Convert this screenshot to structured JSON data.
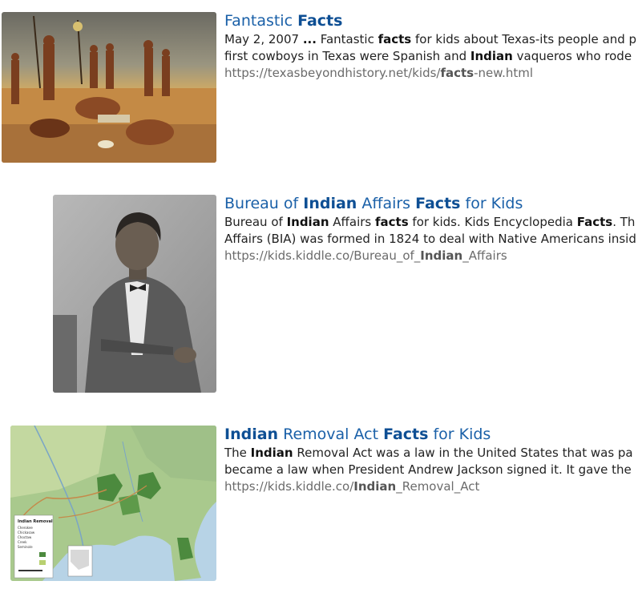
{
  "results": [
    {
      "title": [
        {
          "t": "Fantastic ",
          "b": false
        },
        {
          "t": "Facts",
          "b": true
        }
      ],
      "line1": [
        {
          "t": "May 2, 2007 ",
          "b": false
        },
        {
          "t": "...",
          "b": true
        },
        {
          "t": " Fantastic ",
          "b": false
        },
        {
          "t": "facts",
          "b": true
        },
        {
          "t": " for kids about Texas-its people and p",
          "b": false
        }
      ],
      "line2": [
        {
          "t": "first cowboys in Texas were Spanish and ",
          "b": false
        },
        {
          "t": "Indian",
          "b": true
        },
        {
          "t": " vaqueros who rode",
          "b": false
        }
      ],
      "url": [
        {
          "t": "https://texasbeyondhistory.net/kids/",
          "b": false
        },
        {
          "t": "facts",
          "b": true
        },
        {
          "t": "-new.html",
          "b": false
        }
      ],
      "thumb_icon": "painting-thumbnail"
    },
    {
      "title": [
        {
          "t": "Bureau of ",
          "b": false
        },
        {
          "t": "Indian",
          "b": true
        },
        {
          "t": " Affairs ",
          "b": false
        },
        {
          "t": "Facts",
          "b": true
        },
        {
          "t": " for Kids",
          "b": false
        }
      ],
      "line1": [
        {
          "t": "Bureau of ",
          "b": false
        },
        {
          "t": "Indian",
          "b": true
        },
        {
          "t": " Affairs ",
          "b": false
        },
        {
          "t": "facts",
          "b": true
        },
        {
          "t": " for kids. Kids Encyclopedia ",
          "b": false
        },
        {
          "t": "Facts",
          "b": true
        },
        {
          "t": ". Th",
          "b": false
        }
      ],
      "line2": [
        {
          "t": "Affairs (BIA) was formed in 1824 to deal with Native Americans insid",
          "b": false
        }
      ],
      "url": [
        {
          "t": "https://kids.kiddle.co/Bureau_of_",
          "b": false
        },
        {
          "t": "Indian",
          "b": true
        },
        {
          "t": "_Affairs",
          "b": false
        }
      ],
      "thumb_icon": "portrait-photo-thumbnail"
    },
    {
      "title": [
        {
          "t": "Indian",
          "b": true
        },
        {
          "t": " Removal Act ",
          "b": false
        },
        {
          "t": "Facts",
          "b": true
        },
        {
          "t": " for Kids",
          "b": false
        }
      ],
      "line1": [
        {
          "t": "The ",
          "b": false
        },
        {
          "t": "Indian",
          "b": true
        },
        {
          "t": " Removal Act was a law in the United States that was pa",
          "b": false
        }
      ],
      "line2": [
        {
          "t": "became a law when President Andrew Jackson signed it. It gave the",
          "b": false
        }
      ],
      "url": [
        {
          "t": "https://kids.kiddle.co/",
          "b": false
        },
        {
          "t": "Indian",
          "b": true
        },
        {
          "t": "_Removal_Act",
          "b": false
        }
      ],
      "thumb_icon": "map-thumbnail",
      "map_legend_title": "Indian Removal",
      "map_legend_items": [
        "Cherokee",
        "Chickasaw",
        "Choctaw",
        "Creek",
        "Seminole"
      ]
    }
  ],
  "colors": {
    "title": "#1a60a8",
    "url": "#6b6b6b",
    "snippet": "#222222"
  }
}
